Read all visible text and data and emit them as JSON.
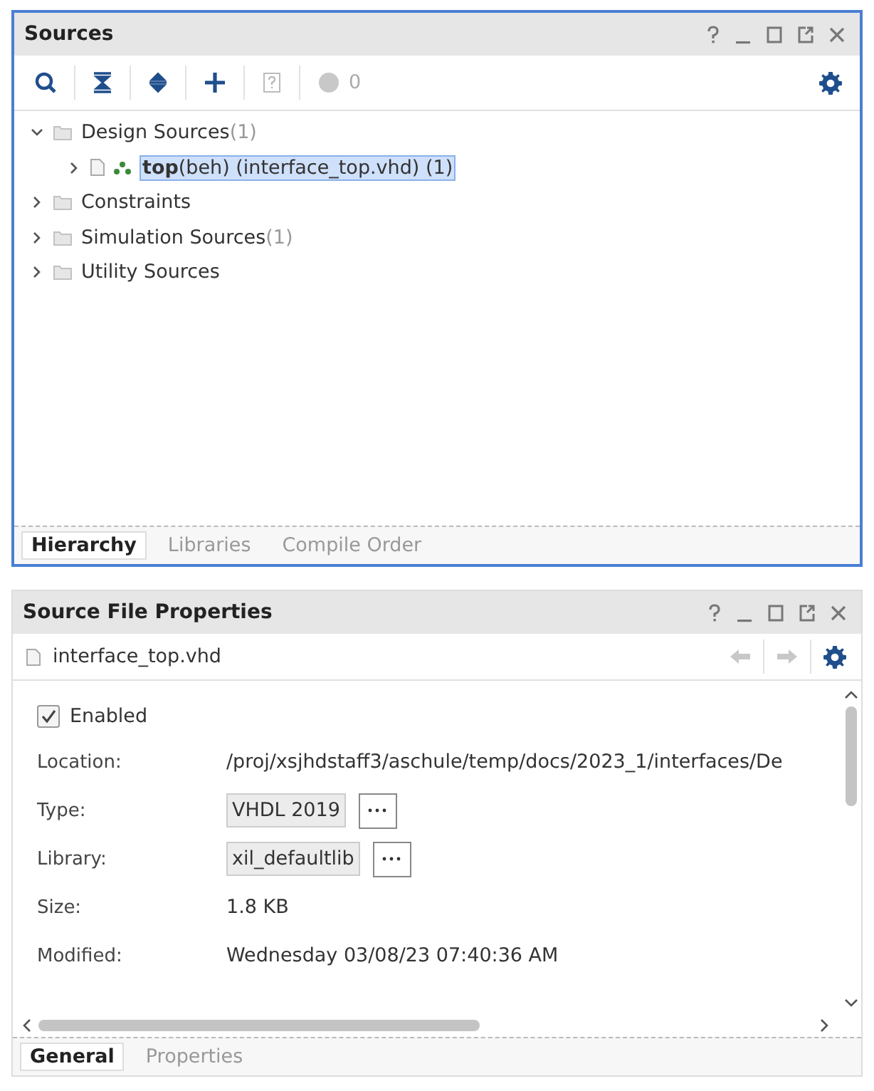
{
  "sources": {
    "title": "Sources",
    "toolbar": {
      "count": "0"
    },
    "tree": [
      {
        "label": "Design Sources",
        "count": "(1)",
        "expanded": true,
        "children": [
          {
            "label": "**top**(beh) (interface_top.vhd) (1)",
            "selected": true,
            "expanded": false
          }
        ]
      },
      {
        "label": "Constraints",
        "expanded": false
      },
      {
        "label": "Simulation Sources",
        "count": "(1)",
        "expanded": false
      },
      {
        "label": "Utility Sources",
        "expanded": false
      }
    ],
    "tabs": [
      {
        "label": "Hierarchy",
        "selected": true
      },
      {
        "label": "Libraries",
        "selected": false
      },
      {
        "label": "Compile Order",
        "selected": false
      }
    ]
  },
  "properties": {
    "title": "Source File Properties",
    "file": "interface_top.vhd",
    "enabled": {
      "label": "Enabled",
      "checked": true
    },
    "fields": [
      {
        "label": "Location:",
        "value": "/proj/xsjhdstaff3/aschule/temp/docs/2023_1/interfaces/De",
        "kind": "text"
      },
      {
        "label": "Type:",
        "value": "VHDL 2019",
        "kind": "combo"
      },
      {
        "label": "Library:",
        "value": "xil_defaultlib",
        "kind": "combo"
      },
      {
        "label": "Size:",
        "value": "1.8 KB",
        "kind": "text"
      },
      {
        "label": "Modified:",
        "value": "Wednesday 03/08/23 07:40:36 AM",
        "kind": "text"
      }
    ],
    "tabs": [
      {
        "label": "General",
        "selected": true
      },
      {
        "label": "Properties",
        "selected": false
      }
    ]
  }
}
